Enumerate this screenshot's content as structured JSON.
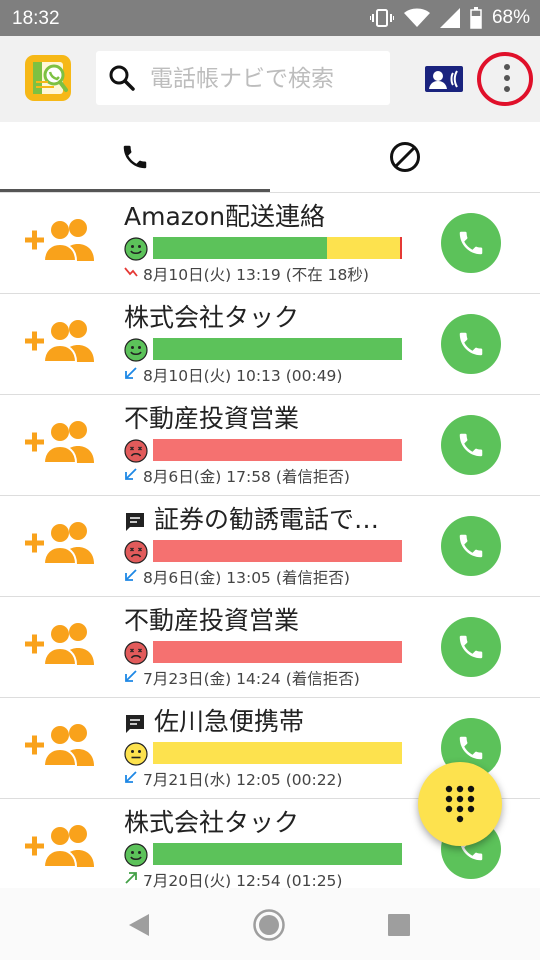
{
  "status_bar": {
    "time": "18:32",
    "battery": "68%"
  },
  "search": {
    "placeholder": "電話帳ナビで検索",
    "value": ""
  },
  "colors": {
    "green": "#5cc25a",
    "yellow": "#fde24e",
    "red": "#f57170",
    "orange": "#f9a21b",
    "missed": "#e53935",
    "incoming": "#1e88e5",
    "outgoing": "#43a047"
  },
  "calls": [
    {
      "name": "Amazon配送連絡",
      "note": false,
      "rating": "good",
      "bar": [
        {
          "color": "#5cc25a",
          "fraction": 0.7
        },
        {
          "color": "#fde24e",
          "fraction": 0.29
        },
        {
          "color": "#e53935",
          "fraction": 0.01
        }
      ],
      "direction": "missed",
      "meta": "8月10日(火) 13:19 (不在 18秒)"
    },
    {
      "name": "株式会社タック",
      "note": false,
      "rating": "good",
      "bar": [
        {
          "color": "#5cc25a",
          "fraction": 1
        }
      ],
      "direction": "incoming",
      "meta": "8月10日(火) 10:13 (00:49)"
    },
    {
      "name": "不動産投資営業",
      "note": false,
      "rating": "bad",
      "bar": [
        {
          "color": "#f57170",
          "fraction": 1
        }
      ],
      "direction": "incoming",
      "meta": "8月6日(金) 17:58 (着信拒否)"
    },
    {
      "name": "証券の勧誘電話で…",
      "note": true,
      "rating": "bad",
      "bar": [
        {
          "color": "#f57170",
          "fraction": 1
        }
      ],
      "direction": "incoming",
      "meta": "8月6日(金) 13:05 (着信拒否)"
    },
    {
      "name": "不動産投資営業",
      "note": false,
      "rating": "bad",
      "bar": [
        {
          "color": "#f57170",
          "fraction": 1
        }
      ],
      "direction": "incoming",
      "meta": "7月23日(金) 14:24 (着信拒否)"
    },
    {
      "name": "佐川急便携帯",
      "note": true,
      "rating": "neutral",
      "bar": [
        {
          "color": "#fde24e",
          "fraction": 1
        }
      ],
      "direction": "incoming",
      "meta": "7月21日(水) 12:05 (00:22)"
    },
    {
      "name": "株式会社タック",
      "note": false,
      "rating": "good",
      "bar": [
        {
          "color": "#5cc25a",
          "fraction": 1
        }
      ],
      "direction": "outgoing",
      "meta": "7月20日(火) 12:54 (01:25)"
    }
  ]
}
